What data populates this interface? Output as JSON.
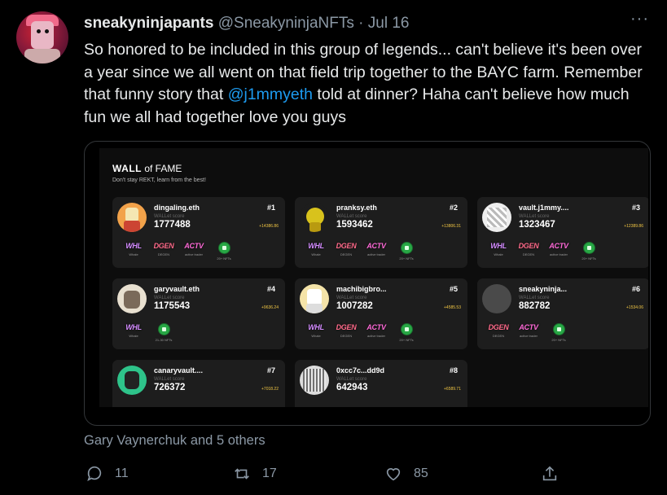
{
  "tweet": {
    "display_name": "sneakyninjapants",
    "handle": "@SneakyninjaNFTs",
    "separator": "·",
    "date": "Jul 16",
    "more": "···",
    "text_part1": "So honored to be included in this group of legends... can't believe it's been over a year since we all went on that field trip together to the BAYC farm. Remember that funny story that ",
    "mention": "@j1mmyeth",
    "text_part2": " told at dinner? Haha can't believe how much fun we all had together love you guys",
    "liked_by": "Gary Vaynerchuk and 5 others",
    "replies": "11",
    "retweets": "17",
    "likes": "85"
  },
  "card": {
    "title_bold": "WALL",
    "title_rest": " of FAME",
    "subtitle": "Don't stay REKT, learn from the best!",
    "score_label": "WALLet score",
    "entries": [
      {
        "name": "dingaling.eth",
        "rank": "#1",
        "score": "1777488",
        "delta": "+14386.86"
      },
      {
        "name": "pranksy.eth",
        "rank": "#2",
        "score": "1593462",
        "delta": "+13806.31"
      },
      {
        "name": "vault.j1mmy....",
        "rank": "#3",
        "score": "1323467",
        "delta": "+12389.86"
      },
      {
        "name": "garyvault.eth",
        "rank": "#4",
        "score": "1175543",
        "delta": "+9636.24"
      },
      {
        "name": "machibigbro...",
        "rank": "#5",
        "score": "1007282",
        "delta": "+4585.53"
      },
      {
        "name": "sneakyninja...",
        "rank": "#6",
        "score": "882782",
        "delta": "+1534.06"
      },
      {
        "name": "canaryvault....",
        "rank": "#7",
        "score": "726372",
        "delta": "+7018.22"
      },
      {
        "name": "0xcc7c...dd9d",
        "rank": "#8",
        "score": "642943",
        "delta": "+6589.71"
      }
    ],
    "badges": {
      "whl": "WHL",
      "whl_sub": "Whale",
      "dgen": "DGEN",
      "dgen_sub": "DEGEN",
      "actv": "ACTV",
      "actv_sub": "active trader",
      "nft_sub": "20+ NFTs",
      "nft_sub2": "21-30 NFTs"
    }
  },
  "colors": {
    "background": "#000000",
    "text": "#e7e9ea",
    "muted": "#8b98a5",
    "link": "#1d9bf0",
    "tile": "#1d1d1d",
    "delta": "#f2c744"
  },
  "icons": [
    "more-icon",
    "reply-icon",
    "retweet-icon",
    "like-icon",
    "share-icon"
  ]
}
